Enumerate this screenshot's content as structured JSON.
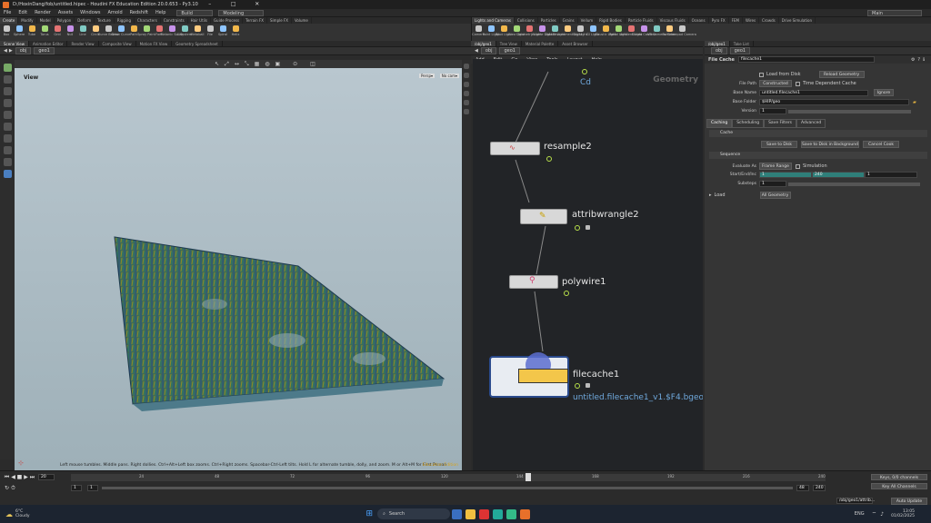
{
  "window": {
    "title": "D:/HoxinDang/fob/untitled.hipec - Houdini FX Education Edition 20.0.653 - Py3.10",
    "controls": [
      "–",
      "□",
      "✕"
    ]
  },
  "menubar": {
    "items": [
      "File",
      "Edit",
      "Render",
      "Assets",
      "Windows",
      "Arnold",
      "Redshift",
      "Help"
    ],
    "desktop_dd": "Build",
    "context_dd": "Modeling",
    "session_dd": "Main"
  },
  "shelf": {
    "tabs_left": [
      "Create",
      "Modify",
      "Model",
      "Polygon",
      "Deform",
      "Texture",
      "Rigging",
      "Characters",
      "Constraints",
      "Hair Utils",
      "Guide Process",
      "Terrain FX",
      "Simple FX",
      "Volume"
    ],
    "tools_left": [
      "Box",
      "Sphere",
      "Tube",
      "Torus",
      "Grid",
      "Null",
      "Line",
      "Circle",
      "Curve Bezier",
      "Draw Curve",
      "Path",
      "Spray Paint",
      "Font",
      "Platonic Solids",
      "L-System",
      "Metaball",
      "File",
      "Spiral",
      "Helix"
    ],
    "tabs_right": [
      "Lights and Cameras",
      "Collisions",
      "Particles",
      "Grains",
      "Vellum",
      "Rigid Bodies",
      "Particle Fluids",
      "Viscous Fluids",
      "Oceans",
      "Pyro FX",
      "FEM",
      "Wires",
      "Crowds",
      "Drive Simulation"
    ],
    "tools_right": [
      "Camera",
      "Point Light",
      "Spot Light",
      "Area Light",
      "Geometry Light",
      "Volume Light",
      "Distant Light",
      "Environment Light",
      "Sky Light",
      "GI Light",
      "Caustic Light",
      "Portal Light",
      "Ambient Light",
      "Stereo Camera",
      "VR Camera",
      "Switcher",
      "Gamepad Camera"
    ]
  },
  "viewport": {
    "tabs": [
      "Scene View",
      "Animation Editor",
      "Render View",
      "Composite View",
      "Motion FX View",
      "Geometry Spreadsheet"
    ],
    "path": [
      "obj",
      "geo1"
    ],
    "label": "View",
    "persp": "Persp▾",
    "camera": "No cam▾",
    "status": "Left mouse tumbles. Middle pans. Right dollies. Ctrl+Alt+Left box zooms. Ctrl+Right zooms. Spacebar-Ctrl-Left tilts. Hold L for alternate tumble, dolly, and zoom. M or Alt+M for First Person Navigation.",
    "badge": "Education Edition"
  },
  "network": {
    "tabs": [
      "/obj/geo1",
      "Tree View",
      "Material Palette",
      "Asset Browser"
    ],
    "path": [
      "obj",
      "geo1"
    ],
    "menu": [
      "Add",
      "Edit",
      "Go",
      "View",
      "Tools",
      "Layout",
      "Help"
    ],
    "context_label": "Geometry",
    "attr_label": "Cd",
    "nodes": [
      {
        "name": "resample2",
        "sub": ""
      },
      {
        "name": "attribwrangle2",
        "sub": ""
      },
      {
        "name": "polywire1",
        "sub": ""
      },
      {
        "name": "filecache1",
        "sub": "untitled.filecache1_v1.$F4.bgeo"
      }
    ]
  },
  "parms": {
    "tabs": [
      "/obj/geo1",
      "Take List"
    ],
    "path": [
      "obj",
      "geo1"
    ],
    "node_type": "File Cache",
    "node_name": "filecache1",
    "load_from_disk": "Load from Disk",
    "reload_geometry": "Reload Geometry",
    "file_path_label": "File Path",
    "file_path_value": "Constructed",
    "time_dependent": "Time Dependent Cache",
    "base_name_label": "Base Name",
    "base_name_value": "untitled.filecache1",
    "base_name_dd": "Ignore",
    "base_folder_label": "Base Folder",
    "base_folder_value": "$HIP/geo",
    "version_label": "Version",
    "version_value": "1",
    "subtabs": [
      "Caching",
      "Scheduling",
      "Save Filters",
      "Advanced"
    ],
    "cache_section": "Cache",
    "save_to_disk": "Save to Disk",
    "save_bg": "Save to Disk in Background",
    "cancel_cook": "Cancel Cook",
    "seq_section": "Sequence",
    "evaluate_label": "Evaluate As",
    "evaluate_value": "Frame Range",
    "simulation": "Simulation",
    "startend_label": "Start/End/Inc",
    "start_value": "1",
    "end_value": "240",
    "inc_value": "1",
    "substeps_label": "Substeps",
    "substeps_value": "1",
    "load_section": "Load",
    "load_value": "All Geometry"
  },
  "timeline": {
    "frame": "20",
    "range_start": "1",
    "range_start2": "1",
    "range_end": "240",
    "range_end2": "48",
    "ticks": [
      "24",
      "48",
      "72",
      "96",
      "120",
      "144",
      "168",
      "192",
      "216",
      "240"
    ],
    "channels_label": "Keys, 0/0 channels",
    "key_all": "Key All Channels",
    "auto_update": "Auto Update",
    "path_field": "/obj/geo1/attrib..."
  },
  "taskbar": {
    "weather_temp": "6°C",
    "weather_text": "Cloudy",
    "search": "Search",
    "lang": "ENG",
    "time": "13:05",
    "date": "01/02/2025"
  }
}
